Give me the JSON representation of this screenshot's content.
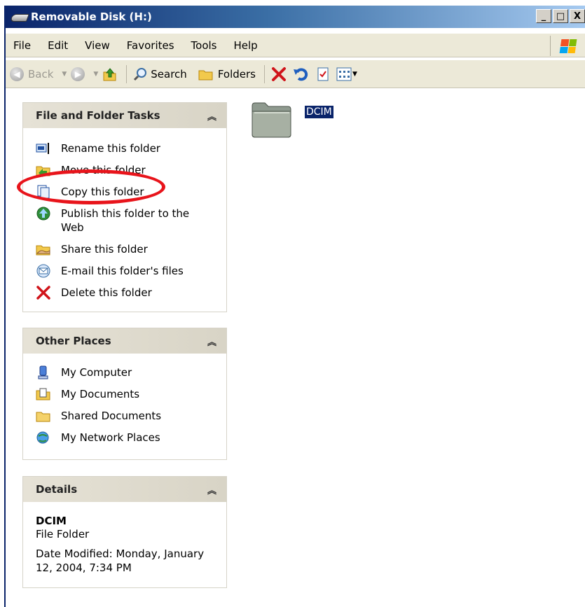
{
  "window": {
    "title": "Removable Disk (H:)",
    "controls": [
      "_",
      "□",
      "X"
    ]
  },
  "menubar": {
    "items": [
      "File",
      "Edit",
      "View",
      "Favorites",
      "Tools",
      "Help"
    ]
  },
  "toolbar": {
    "back_label": "Back",
    "search_label": "Search",
    "folders_label": "Folders"
  },
  "file_folder_tasks": {
    "title": "File and Folder Tasks",
    "items": [
      {
        "label": "Rename this folder",
        "icon": "rename-icon"
      },
      {
        "label": "Move this folder",
        "icon": "move-icon"
      },
      {
        "label": "Copy this folder",
        "icon": "copy-icon"
      },
      {
        "label": "Publish this folder to the Web",
        "icon": "publish-web-icon"
      },
      {
        "label": "Share this folder",
        "icon": "share-folder-icon"
      },
      {
        "label": "E-mail this folder's files",
        "icon": "email-icon"
      },
      {
        "label": "Delete this folder",
        "icon": "delete-icon"
      }
    ]
  },
  "other_places": {
    "title": "Other Places",
    "items": [
      {
        "label": "My Computer",
        "icon": "my-computer-icon"
      },
      {
        "label": "My Documents",
        "icon": "my-documents-icon"
      },
      {
        "label": "Shared Documents",
        "icon": "shared-documents-icon"
      },
      {
        "label": "My Network Places",
        "icon": "network-places-icon"
      }
    ]
  },
  "details": {
    "title": "Details",
    "name": "DCIM",
    "type": "File Folder",
    "modified": "Date Modified: Monday, January 12, 2004, 7:34 PM"
  },
  "content": {
    "folders": [
      {
        "name": "DCIM",
        "selected": true
      }
    ]
  },
  "annotation": {
    "highlight_color": "#e8141b",
    "target": "Copy this folder"
  },
  "colors": {
    "title_bar": "#0a246a",
    "selection": "#0a246a",
    "chrome": "#ece9d8"
  }
}
